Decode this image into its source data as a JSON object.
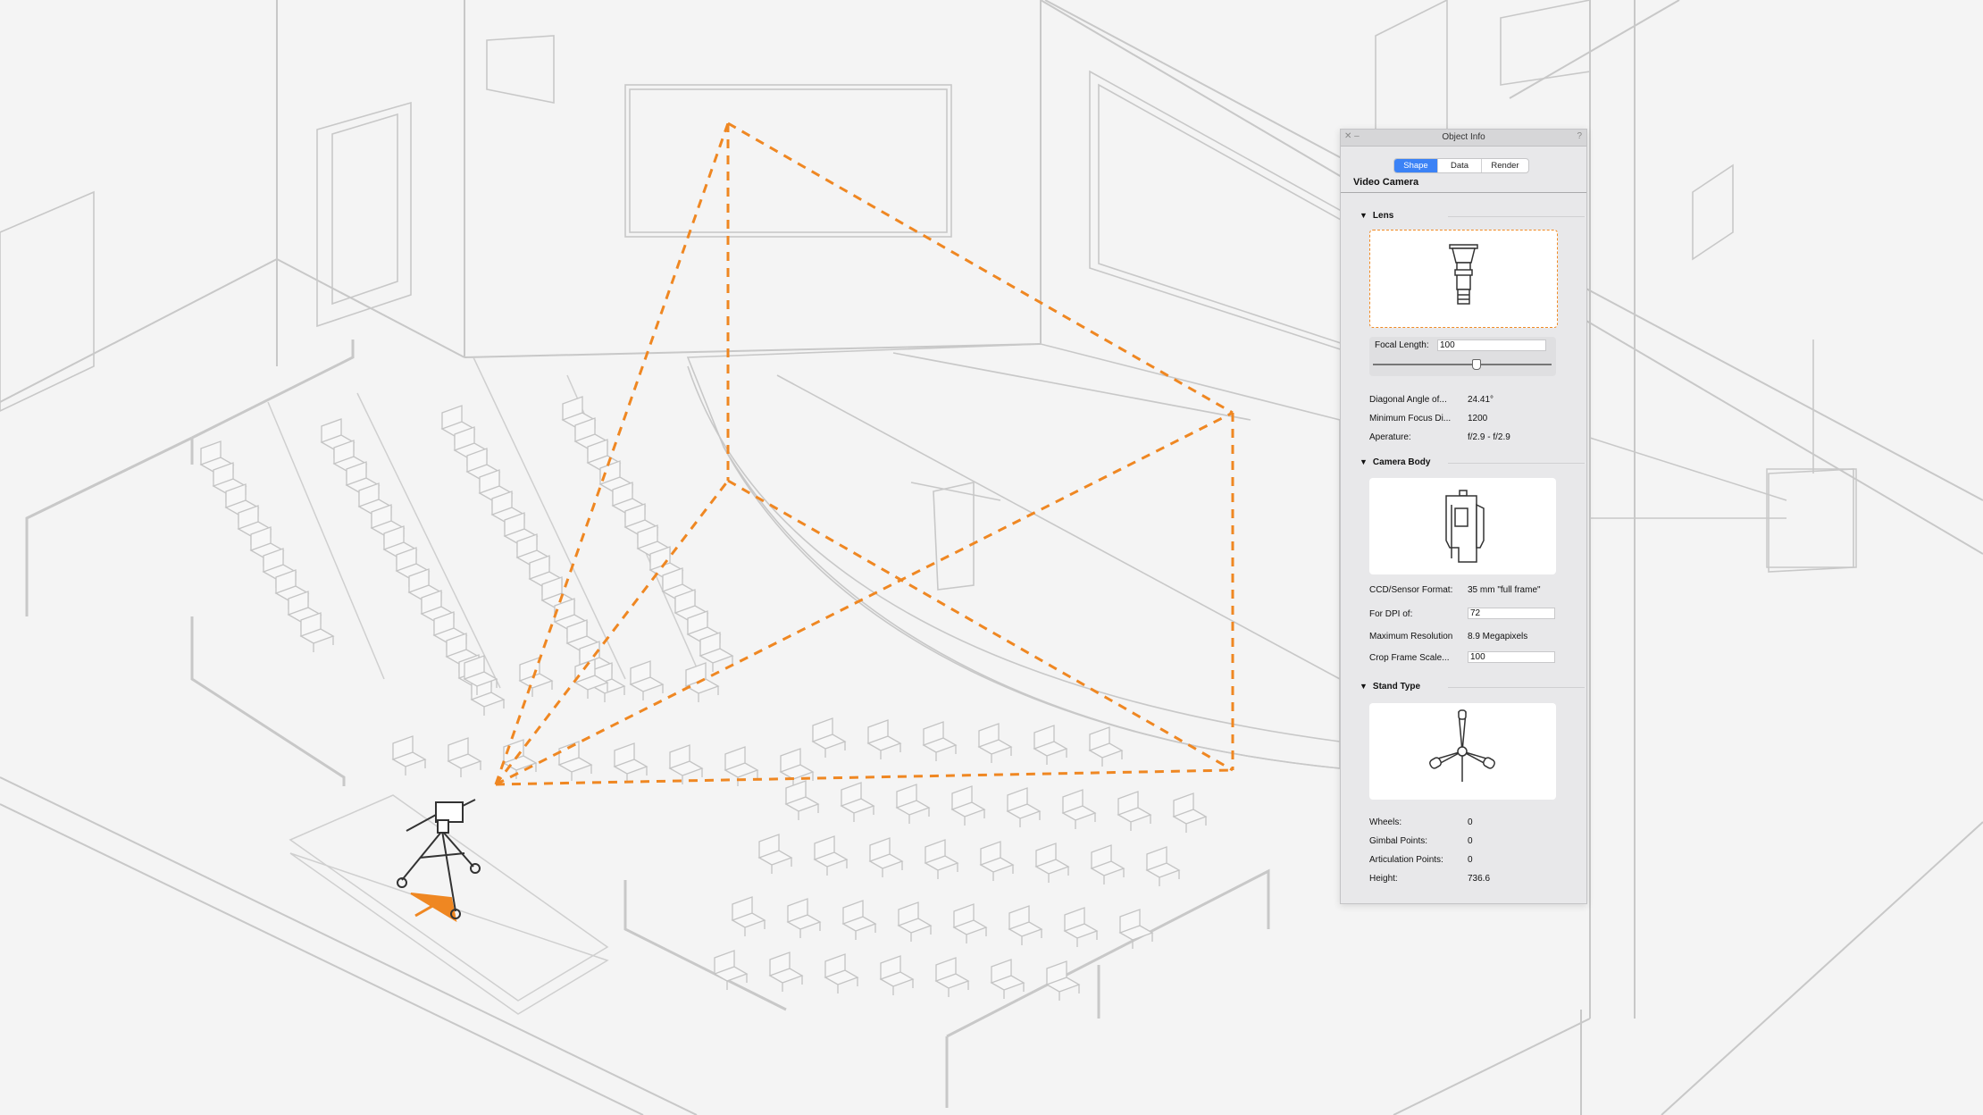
{
  "panel": {
    "title": "Object Info",
    "close_glyph": "✕ –",
    "help_glyph": "?",
    "tabs": [
      {
        "label": "Shape",
        "active": true
      },
      {
        "label": "Data",
        "active": false
      },
      {
        "label": "Render",
        "active": false
      }
    ],
    "object_name": "Video Camera",
    "lens": {
      "header": "Lens",
      "focal_length_label": "Focal Length:",
      "focal_length_value": "100",
      "rows": [
        {
          "label": "Diagonal Angle of...",
          "value": "24.41°"
        },
        {
          "label": "Minimum Focus Di...",
          "value": "1200"
        },
        {
          "label": "Aperature:",
          "value": "f/2.9 - f/2.9"
        }
      ]
    },
    "camera_body": {
      "header": "Camera Body",
      "ccd_label": "CCD/Sensor Format:",
      "ccd_value": "35 mm \"full frame\"",
      "dpi_label": "For DPI of:",
      "dpi_value": "72",
      "maxres_label": "Maximum Resolution",
      "maxres_value": "8.9 Megapixels",
      "crop_label": "Crop Frame Scale...",
      "crop_value": "100"
    },
    "stand_type": {
      "header": "Stand Type",
      "rows": [
        {
          "label": "Wheels:",
          "value": "0"
        },
        {
          "label": "Gimbal Points:",
          "value": "0"
        },
        {
          "label": "Articulation Points:",
          "value": "0"
        },
        {
          "label": "Height:",
          "value": "736.6"
        }
      ]
    }
  },
  "colors": {
    "accent": "#f08a24",
    "tab_active": "#3b82f6",
    "line": "#bdbdbd"
  }
}
